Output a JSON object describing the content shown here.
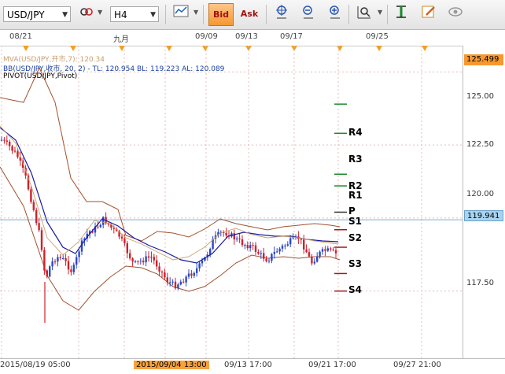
{
  "toolbar": {
    "symbol": "USD/JPY",
    "timeframe": "H4",
    "bid_label": "Bid",
    "ask_label": "Ask"
  },
  "top_axis": {
    "labels": [
      "08/21",
      "九月",
      "09/09",
      "09/13",
      "09/17",
      "09/25"
    ]
  },
  "bottom_axis": {
    "labels": [
      "2015/08/19 05:00",
      "2015/09/04 13:00",
      "09/13 17:00",
      "09/21 17:00",
      "09/27 21:00"
    ],
    "highlighted": "2015/09/04 13:00"
  },
  "legend": {
    "mva": "MVA(USD/JPY,开市,7): 120.34",
    "bb": "BB(USD/JPY,收市, 20, 2) -  TL: 120.954  BL: 119.223  AL: 120.089",
    "pivot": "PIVOT(USD/JPY,Pivot)"
  },
  "price_scale": {
    "ticks": [
      "125.00",
      "122.50",
      "120.00",
      "117.50"
    ],
    "top_box": "125.499",
    "current_box": "119.941"
  },
  "pivot_levels": [
    "R4",
    "R3",
    "R2",
    "R1",
    "P",
    "S1",
    "S2",
    "S3",
    "S4"
  ],
  "colors": {
    "bull": "#2a47c9",
    "bear": "#d0202c",
    "ma_blue": "#1a1a9c",
    "bb": "#a0522d",
    "mva": "#c8a070",
    "accent": "#f5982f"
  },
  "chart_data": {
    "type": "candlestick",
    "y_range": [
      115.2,
      125.9
    ],
    "ticks": [
      125.0,
      122.5,
      120.0,
      117.5
    ],
    "current_price": 119.941,
    "pivot_prices": {
      "R4": 123.9,
      "R3": 122.9,
      "R2": 121.5,
      "R1": 121.1,
      "P": 120.2,
      "S1": 119.6,
      "S2": 119.0,
      "S3": 118.1,
      "S4": 117.5
    }
  }
}
